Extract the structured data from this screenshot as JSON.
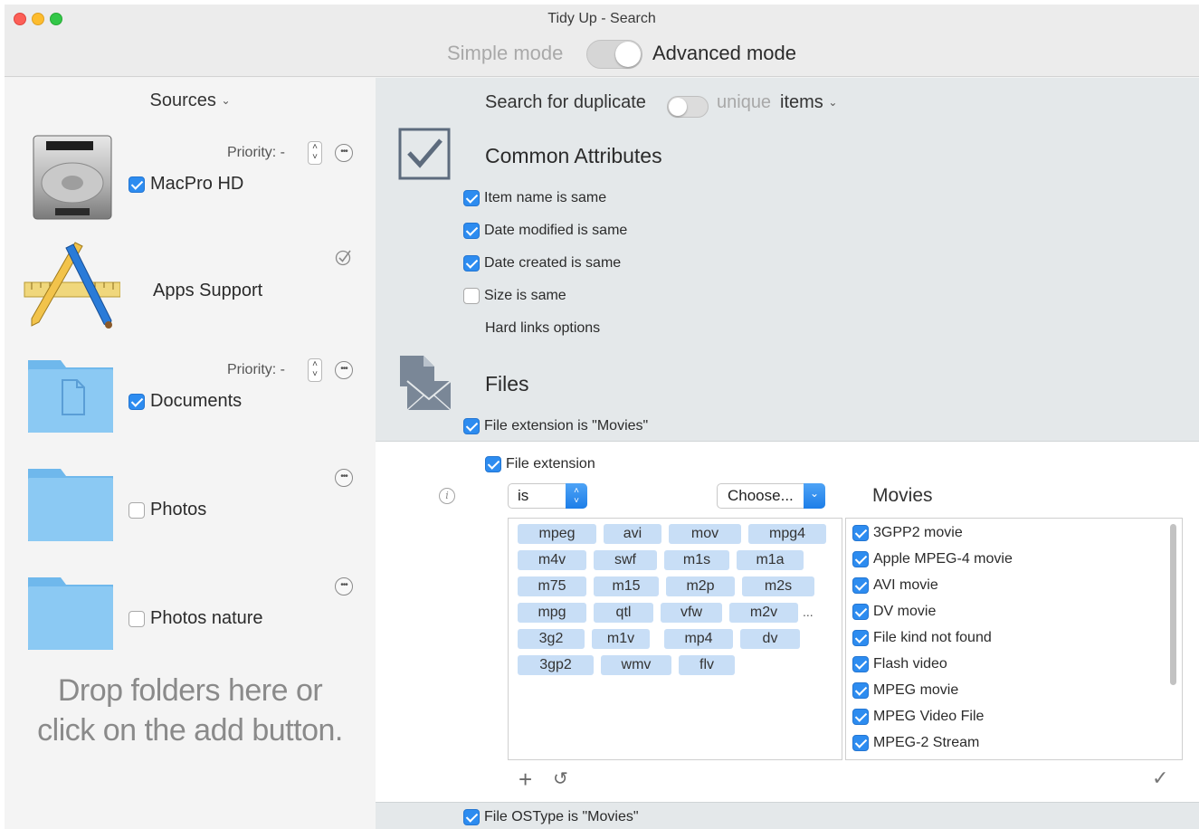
{
  "window": {
    "title": "Tidy Up - Search",
    "mode_simple": "Simple mode",
    "mode_advanced": "Advanced mode",
    "advanced_on": true
  },
  "sidebar": {
    "header": "Sources",
    "sources": [
      {
        "label": "MacPro HD",
        "checked": true,
        "priority_label": "Priority: -",
        "icon": "hard-drive-icon",
        "more": true
      },
      {
        "label": "Apps Support",
        "checked": null,
        "icon": "app-support-icon",
        "done": true
      },
      {
        "label": "Documents",
        "checked": true,
        "priority_label": "Priority: -",
        "icon": "documents-folder-icon",
        "more": true
      },
      {
        "label": "Photos",
        "checked": false,
        "icon": "folder-icon",
        "more": true
      },
      {
        "label": "Photos nature",
        "checked": false,
        "icon": "folder-icon",
        "more": true
      }
    ],
    "drop_hint_line1": "Drop folders here or",
    "drop_hint_line2": "click on the add button."
  },
  "search": {
    "label_left": "Search for duplicate",
    "label_unique": "unique",
    "label_items": "items",
    "unique_on": false
  },
  "common": {
    "title": "Common Attributes",
    "items": [
      {
        "label": "Item name is same",
        "checked": true
      },
      {
        "label": "Date modified is same",
        "checked": true
      },
      {
        "label": "Date created is same",
        "checked": true
      },
      {
        "label": "Size is same",
        "checked": false
      }
    ],
    "hard_links": "Hard links options"
  },
  "files": {
    "title": "Files",
    "extension_row": "File extension is \"Movies\"",
    "extension_checked": true
  },
  "extension_editor": {
    "label": "File extension",
    "checked": true,
    "operator": "is",
    "choose": "Choose...",
    "category_title": "Movies",
    "tags": [
      "mpeg",
      "avi",
      "mov",
      "mpg4",
      "m4v",
      "swf",
      "m1s",
      "m1a",
      "m75",
      "m15",
      "m2p",
      "m2s",
      "mpg",
      "qtl",
      "vfw",
      "m2v",
      "3g2",
      "m1v",
      "mp4",
      "dv",
      "3gp2",
      "wmv",
      "flv"
    ],
    "more": "...",
    "kinds": [
      {
        "label": "3GPP2 movie",
        "checked": true
      },
      {
        "label": "Apple MPEG-4 movie",
        "checked": true
      },
      {
        "label": "AVI movie",
        "checked": true
      },
      {
        "label": "DV movie",
        "checked": true
      },
      {
        "label": "File kind not found",
        "checked": true
      },
      {
        "label": "Flash video",
        "checked": true
      },
      {
        "label": "MPEG movie",
        "checked": true
      },
      {
        "label": "MPEG Video File",
        "checked": true
      },
      {
        "label": "MPEG-2 Stream",
        "checked": true
      }
    ],
    "add_symbol": "+",
    "undo_symbol": "↺",
    "apply_symbol": "✓"
  },
  "ostype": {
    "label": "File OSType is \"Movies\"",
    "checked": true
  },
  "colors": {
    "accent": "#2d8cf0",
    "tag_bg": "#c8def6",
    "panel_bg": "#e4e8ea",
    "folder": "#7cc0ef"
  }
}
